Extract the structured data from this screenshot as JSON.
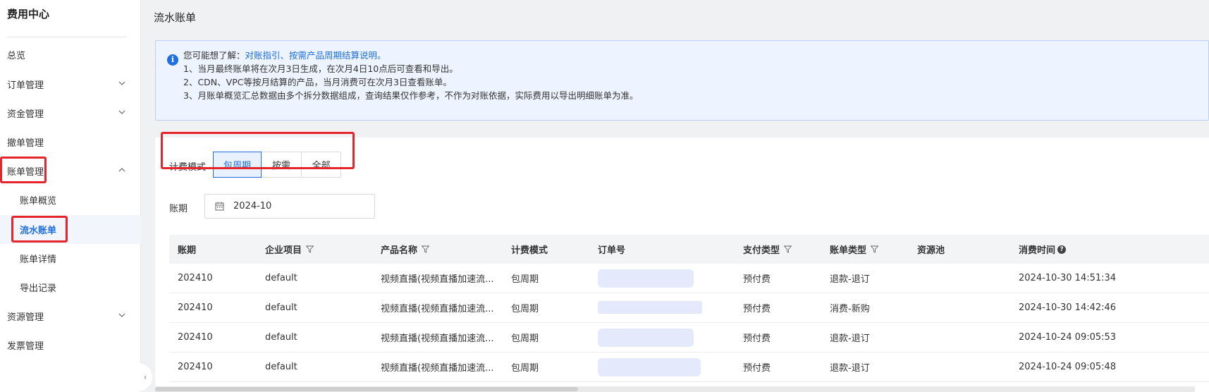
{
  "sidebar": {
    "title": "费用中心",
    "items": [
      {
        "label": "总览"
      },
      {
        "label": "订单管理"
      },
      {
        "label": "资金管理"
      },
      {
        "label": "撤单管理"
      },
      {
        "label": "账单管理"
      },
      {
        "label": "账单概览"
      },
      {
        "label": "流水账单"
      },
      {
        "label": "账单详情"
      },
      {
        "label": "导出记录"
      },
      {
        "label": "资源管理"
      },
      {
        "label": "发票管理"
      }
    ]
  },
  "page": {
    "title": "流水账单"
  },
  "notice": {
    "intro": "您可能想了解：",
    "link": "对账指引、按需产品周期结算说明。",
    "line1": "1、当月最终账单将在次月3日生成，在次月4日10点后可查看和导出。",
    "line2": "2、CDN、VPC等按月结算的产品，当月消费可在次月3日查看账单。",
    "line3": "3、月账单概览汇总数据由多个拆分数据组成，查询结果仅作参考，不作为对账依据，实际费用以导出明细账单为准。"
  },
  "filters": {
    "billing_mode_label": "计费模式",
    "modes": [
      "包周期",
      "按需",
      "全部"
    ],
    "active_mode": "包周期",
    "period_label": "账期",
    "period_value": "2024-10"
  },
  "table": {
    "headers": [
      "账期",
      "企业项目",
      "产品名称",
      "计费模式",
      "订单号",
      "支付类型",
      "账单类型",
      "资源池",
      "消费时间"
    ],
    "rows": [
      [
        "202410",
        "default",
        "视频直播(视频直播加速流...",
        "包周期",
        "",
        "预付费",
        "退款-退订",
        "",
        "2024-10-30 14:51:34"
      ],
      [
        "202410",
        "default",
        "视频直播(视频直播加速流...",
        "包周期",
        "",
        "预付费",
        "消费-新购",
        "",
        "2024-10-30 14:42:46"
      ],
      [
        "202410",
        "default",
        "视频直播(视频直播加速流...",
        "包周期",
        "",
        "预付费",
        "退款-退订",
        "",
        "2024-10-24 09:05:53"
      ],
      [
        "202410",
        "default",
        "视频直播(视频直播加速流...",
        "包周期",
        "",
        "预付费",
        "退款-退订",
        "",
        "2024-10-24 09:05:48"
      ]
    ]
  },
  "colors": {
    "accent": "#1e6fe0",
    "highlight": "#e5242b"
  }
}
